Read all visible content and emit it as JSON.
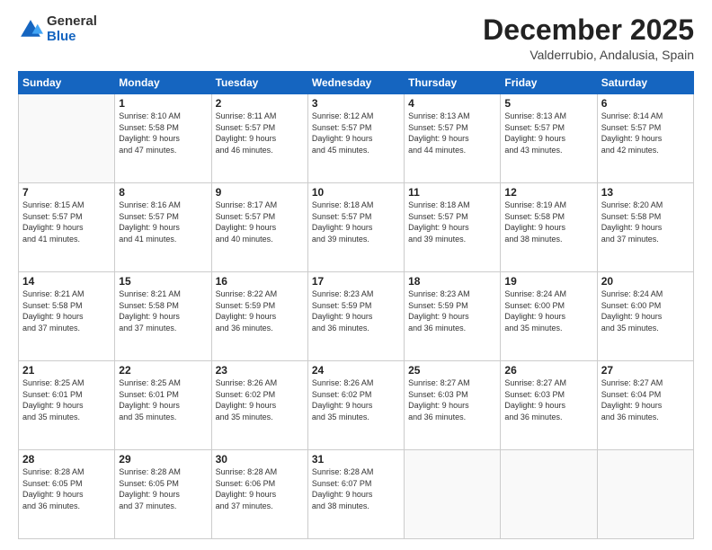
{
  "logo": {
    "line1": "General",
    "line2": "Blue"
  },
  "header": {
    "month": "December 2025",
    "location": "Valderrubio, Andalusia, Spain"
  },
  "weekdays": [
    "Sunday",
    "Monday",
    "Tuesday",
    "Wednesday",
    "Thursday",
    "Friday",
    "Saturday"
  ],
  "weeks": [
    [
      {
        "day": "",
        "info": ""
      },
      {
        "day": "1",
        "info": "Sunrise: 8:10 AM\nSunset: 5:58 PM\nDaylight: 9 hours\nand 47 minutes."
      },
      {
        "day": "2",
        "info": "Sunrise: 8:11 AM\nSunset: 5:57 PM\nDaylight: 9 hours\nand 46 minutes."
      },
      {
        "day": "3",
        "info": "Sunrise: 8:12 AM\nSunset: 5:57 PM\nDaylight: 9 hours\nand 45 minutes."
      },
      {
        "day": "4",
        "info": "Sunrise: 8:13 AM\nSunset: 5:57 PM\nDaylight: 9 hours\nand 44 minutes."
      },
      {
        "day": "5",
        "info": "Sunrise: 8:13 AM\nSunset: 5:57 PM\nDaylight: 9 hours\nand 43 minutes."
      },
      {
        "day": "6",
        "info": "Sunrise: 8:14 AM\nSunset: 5:57 PM\nDaylight: 9 hours\nand 42 minutes."
      }
    ],
    [
      {
        "day": "7",
        "info": "Sunrise: 8:15 AM\nSunset: 5:57 PM\nDaylight: 9 hours\nand 41 minutes."
      },
      {
        "day": "8",
        "info": "Sunrise: 8:16 AM\nSunset: 5:57 PM\nDaylight: 9 hours\nand 41 minutes."
      },
      {
        "day": "9",
        "info": "Sunrise: 8:17 AM\nSunset: 5:57 PM\nDaylight: 9 hours\nand 40 minutes."
      },
      {
        "day": "10",
        "info": "Sunrise: 8:18 AM\nSunset: 5:57 PM\nDaylight: 9 hours\nand 39 minutes."
      },
      {
        "day": "11",
        "info": "Sunrise: 8:18 AM\nSunset: 5:57 PM\nDaylight: 9 hours\nand 39 minutes."
      },
      {
        "day": "12",
        "info": "Sunrise: 8:19 AM\nSunset: 5:58 PM\nDaylight: 9 hours\nand 38 minutes."
      },
      {
        "day": "13",
        "info": "Sunrise: 8:20 AM\nSunset: 5:58 PM\nDaylight: 9 hours\nand 37 minutes."
      }
    ],
    [
      {
        "day": "14",
        "info": "Sunrise: 8:21 AM\nSunset: 5:58 PM\nDaylight: 9 hours\nand 37 minutes."
      },
      {
        "day": "15",
        "info": "Sunrise: 8:21 AM\nSunset: 5:58 PM\nDaylight: 9 hours\nand 37 minutes."
      },
      {
        "day": "16",
        "info": "Sunrise: 8:22 AM\nSunset: 5:59 PM\nDaylight: 9 hours\nand 36 minutes."
      },
      {
        "day": "17",
        "info": "Sunrise: 8:23 AM\nSunset: 5:59 PM\nDaylight: 9 hours\nand 36 minutes."
      },
      {
        "day": "18",
        "info": "Sunrise: 8:23 AM\nSunset: 5:59 PM\nDaylight: 9 hours\nand 36 minutes."
      },
      {
        "day": "19",
        "info": "Sunrise: 8:24 AM\nSunset: 6:00 PM\nDaylight: 9 hours\nand 35 minutes."
      },
      {
        "day": "20",
        "info": "Sunrise: 8:24 AM\nSunset: 6:00 PM\nDaylight: 9 hours\nand 35 minutes."
      }
    ],
    [
      {
        "day": "21",
        "info": "Sunrise: 8:25 AM\nSunset: 6:01 PM\nDaylight: 9 hours\nand 35 minutes."
      },
      {
        "day": "22",
        "info": "Sunrise: 8:25 AM\nSunset: 6:01 PM\nDaylight: 9 hours\nand 35 minutes."
      },
      {
        "day": "23",
        "info": "Sunrise: 8:26 AM\nSunset: 6:02 PM\nDaylight: 9 hours\nand 35 minutes."
      },
      {
        "day": "24",
        "info": "Sunrise: 8:26 AM\nSunset: 6:02 PM\nDaylight: 9 hours\nand 35 minutes."
      },
      {
        "day": "25",
        "info": "Sunrise: 8:27 AM\nSunset: 6:03 PM\nDaylight: 9 hours\nand 36 minutes."
      },
      {
        "day": "26",
        "info": "Sunrise: 8:27 AM\nSunset: 6:03 PM\nDaylight: 9 hours\nand 36 minutes."
      },
      {
        "day": "27",
        "info": "Sunrise: 8:27 AM\nSunset: 6:04 PM\nDaylight: 9 hours\nand 36 minutes."
      }
    ],
    [
      {
        "day": "28",
        "info": "Sunrise: 8:28 AM\nSunset: 6:05 PM\nDaylight: 9 hours\nand 36 minutes."
      },
      {
        "day": "29",
        "info": "Sunrise: 8:28 AM\nSunset: 6:05 PM\nDaylight: 9 hours\nand 37 minutes."
      },
      {
        "day": "30",
        "info": "Sunrise: 8:28 AM\nSunset: 6:06 PM\nDaylight: 9 hours\nand 37 minutes."
      },
      {
        "day": "31",
        "info": "Sunrise: 8:28 AM\nSunset: 6:07 PM\nDaylight: 9 hours\nand 38 minutes."
      },
      {
        "day": "",
        "info": ""
      },
      {
        "day": "",
        "info": ""
      },
      {
        "day": "",
        "info": ""
      }
    ]
  ]
}
